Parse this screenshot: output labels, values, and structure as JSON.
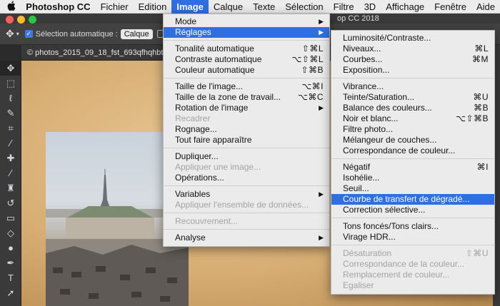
{
  "menubar": {
    "apple": "",
    "items": [
      "Photoshop CC",
      "Fichier",
      "Edition",
      "Image",
      "Calque",
      "Texte",
      "Sélection",
      "Filtre",
      "3D",
      "Affichage",
      "Fenêtre",
      "Aide"
    ]
  },
  "window": {
    "title": "op CC 2018"
  },
  "options_bar": {
    "auto_select_label": "Sélection automatique :",
    "auto_select_value": "Calque"
  },
  "document_tab": {
    "close": "×",
    "title": "© photos_2015_09_18_fst_693qfhqhbt"
  },
  "tools": [
    {
      "icon": "move-icon",
      "glyph": "✥"
    },
    {
      "icon": "marquee-icon",
      "glyph": "⬚"
    },
    {
      "icon": "lasso-icon",
      "glyph": "ℓ"
    },
    {
      "icon": "quick-select-icon",
      "glyph": "✎"
    },
    {
      "icon": "crop-icon",
      "glyph": "⌗"
    },
    {
      "icon": "eyedropper-icon",
      "glyph": "⁄"
    },
    {
      "icon": "healing-icon",
      "glyph": "✚"
    },
    {
      "icon": "brush-icon",
      "glyph": "⁄"
    },
    {
      "icon": "stamp-icon",
      "glyph": "♜"
    },
    {
      "icon": "history-brush-icon",
      "glyph": "↺"
    },
    {
      "icon": "eraser-icon",
      "glyph": "▭"
    },
    {
      "icon": "bucket-icon",
      "glyph": "◇"
    },
    {
      "icon": "dodge-icon",
      "glyph": "●"
    },
    {
      "icon": "pen-icon",
      "glyph": "✒"
    },
    {
      "icon": "type-icon",
      "glyph": "T"
    },
    {
      "icon": "path-select-icon",
      "glyph": "➚"
    }
  ],
  "image_menu": [
    {
      "label": "Mode",
      "shortcut": "",
      "submenu": true
    },
    {
      "label": "Réglages",
      "shortcut": "",
      "submenu": true,
      "highlighted": true
    },
    {
      "separator": true
    },
    {
      "label": "Tonalité automatique",
      "shortcut": "⇧⌘L"
    },
    {
      "label": "Contraste automatique",
      "shortcut": "⌥⇧⌘L"
    },
    {
      "label": "Couleur automatique",
      "shortcut": "⇧⌘B"
    },
    {
      "separator": true
    },
    {
      "label": "Taille de l'image...",
      "shortcut": "⌥⌘I"
    },
    {
      "label": "Taille de la zone de travail...",
      "shortcut": "⌥⌘C"
    },
    {
      "label": "Rotation de l'image",
      "shortcut": "",
      "submenu": true
    },
    {
      "label": "Recadrer",
      "shortcut": "",
      "disabled": true
    },
    {
      "label": "Rognage...",
      "shortcut": ""
    },
    {
      "label": "Tout faire apparaître",
      "shortcut": ""
    },
    {
      "separator": true
    },
    {
      "label": "Dupliquer...",
      "shortcut": ""
    },
    {
      "label": "Appliquer une image...",
      "shortcut": "",
      "disabled": true
    },
    {
      "label": "Opérations...",
      "shortcut": ""
    },
    {
      "separator": true
    },
    {
      "label": "Variables",
      "shortcut": "",
      "submenu": true
    },
    {
      "label": "Appliquer l'ensemble de données...",
      "shortcut": "",
      "disabled": true
    },
    {
      "separator": true
    },
    {
      "label": "Recouvrement...",
      "shortcut": "",
      "disabled": true
    },
    {
      "separator": true
    },
    {
      "label": "Analyse",
      "shortcut": "",
      "submenu": true
    }
  ],
  "adjustments_menu": [
    {
      "label": "Luminosité/Contraste...",
      "shortcut": ""
    },
    {
      "label": "Niveaux...",
      "shortcut": "⌘L"
    },
    {
      "label": "Courbes...",
      "shortcut": "⌘M"
    },
    {
      "label": "Exposition...",
      "shortcut": ""
    },
    {
      "separator": true
    },
    {
      "label": "Vibrance...",
      "shortcut": ""
    },
    {
      "label": "Teinte/Saturation...",
      "shortcut": "⌘U"
    },
    {
      "label": "Balance des couleurs...",
      "shortcut": "⌘B"
    },
    {
      "label": "Noir et blanc...",
      "shortcut": "⌥⇧⌘B"
    },
    {
      "label": "Filtre photo...",
      "shortcut": ""
    },
    {
      "label": "Mélangeur de couches...",
      "shortcut": ""
    },
    {
      "label": "Correspondance de couleur...",
      "shortcut": ""
    },
    {
      "separator": true
    },
    {
      "label": "Négatif",
      "shortcut": "⌘I"
    },
    {
      "label": "Isohélie...",
      "shortcut": ""
    },
    {
      "label": "Seuil...",
      "shortcut": ""
    },
    {
      "label": "Courbe de transfert de dégradé...",
      "shortcut": "",
      "highlighted": true
    },
    {
      "label": "Correction sélective...",
      "shortcut": ""
    },
    {
      "separator": true
    },
    {
      "label": "Tons foncés/Tons clairs...",
      "shortcut": ""
    },
    {
      "label": "Virage HDR...",
      "shortcut": ""
    },
    {
      "separator": true
    },
    {
      "label": "Désaturation",
      "shortcut": "⇧⌘U",
      "disabled": true
    },
    {
      "label": "Correspondance de la couleur...",
      "shortcut": "",
      "disabled": true
    },
    {
      "label": "Remplacement de couleur...",
      "shortcut": "",
      "disabled": true
    },
    {
      "label": "Egaliser",
      "shortcut": "",
      "disabled": true
    }
  ],
  "colors": {
    "accent": "#2f6fe2",
    "menu_bg": "#ebebeb",
    "disabled": "#a3a3a3"
  }
}
